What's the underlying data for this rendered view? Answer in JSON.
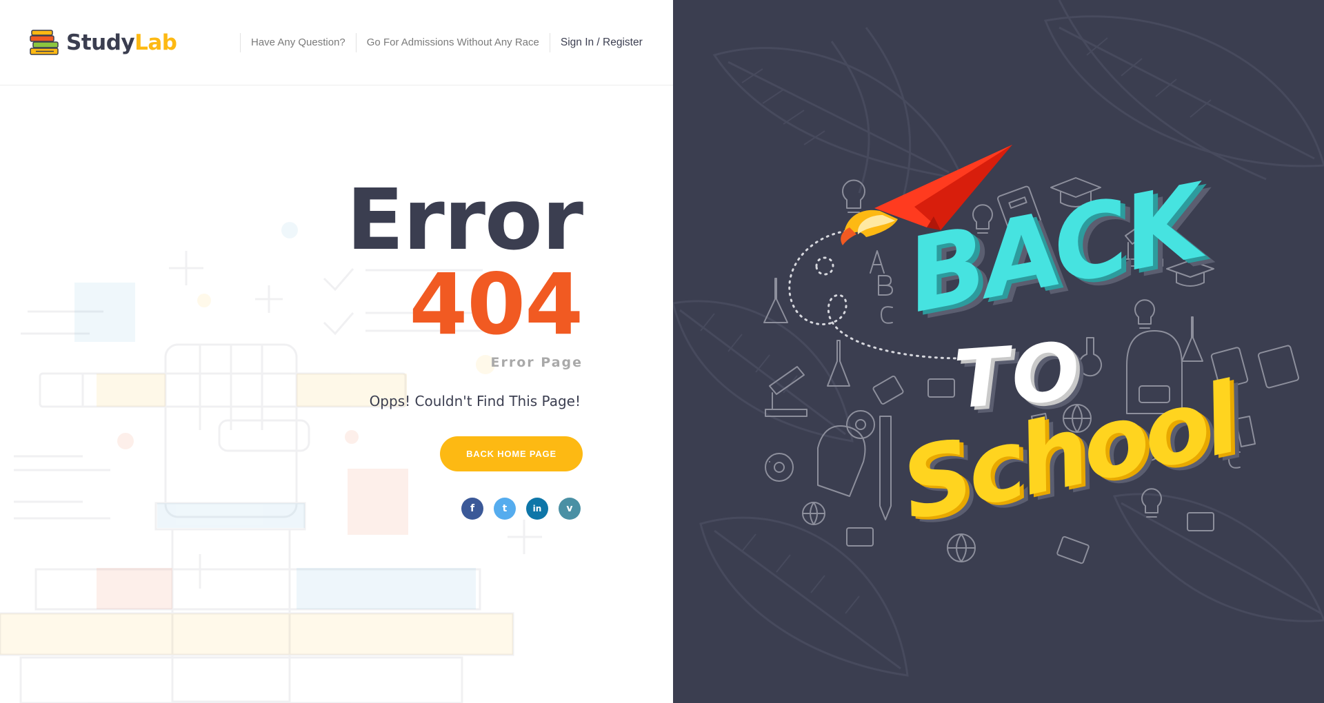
{
  "logo": {
    "part1": "Study",
    "part2": "Lab"
  },
  "nav": {
    "items": [
      {
        "label": "Have Any Question?"
      },
      {
        "label": "Go For Admissions Without Any Race"
      },
      {
        "label": "Sign In / Register"
      }
    ]
  },
  "error": {
    "title": "Error",
    "code": "404",
    "subtitle": "Error Page",
    "message": "Opps! Couldn't Find This Page!",
    "button_label": "BACK HOME PAGE"
  },
  "social": [
    {
      "name": "facebook",
      "glyph": "f",
      "color": "#3b5998"
    },
    {
      "name": "twitter",
      "glyph": "t",
      "color": "#55acee"
    },
    {
      "name": "linkedin",
      "glyph": "in",
      "color": "#0e76a8"
    },
    {
      "name": "vimeo",
      "glyph": "v",
      "color": "#4a90a4"
    }
  ],
  "illustration": {
    "line1": "BACK",
    "line2": "TO",
    "line3": "School"
  },
  "colors": {
    "dark": "#3b3e50",
    "accent_orange": "#f15a22",
    "accent_yellow": "#fdb913",
    "panel_bg": "#3b3e50"
  }
}
